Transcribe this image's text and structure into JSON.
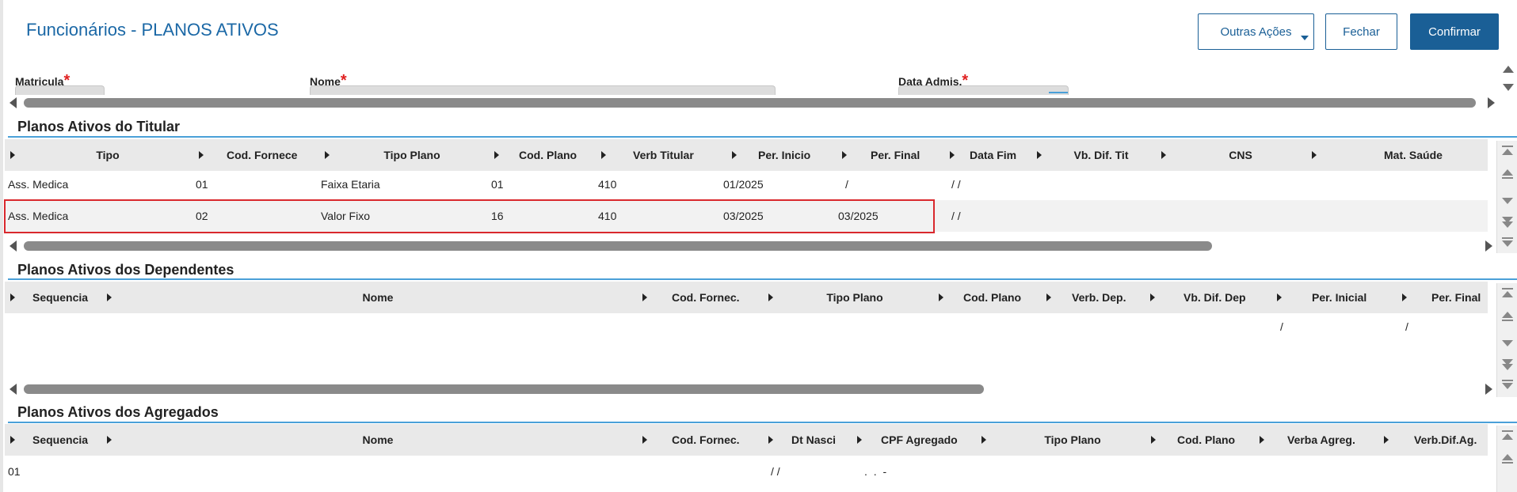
{
  "header": {
    "title": "Funcionários - PLANOS ATIVOS",
    "buttons": {
      "other_actions": "Outras Ações",
      "close": "Fechar",
      "confirm": "Confirmar"
    }
  },
  "form": {
    "matricula_label": "Matricula",
    "nome_label": "Nome",
    "data_admis_label": "Data Admis.",
    "required_mark": "*"
  },
  "titular": {
    "title": "Planos Ativos do Titular",
    "columns": [
      "Tipo",
      "Cod. Fornece",
      "Tipo Plano",
      "Cod. Plano",
      "Verb Titular",
      "Per. Inicio",
      "Per. Final",
      "Data Fim",
      "Vb. Dif. Tit",
      "CNS",
      "Mat. Saúde"
    ],
    "rows": [
      [
        "Ass. Medica",
        "01",
        "Faixa Etaria",
        "01",
        "410",
        "01/2025",
        "/",
        "/ /"
      ],
      [
        "Ass. Medica",
        "02",
        "Valor Fixo",
        "16",
        "410",
        "03/2025",
        "03/2025",
        "/ /"
      ]
    ]
  },
  "dependentes": {
    "title": "Planos Ativos dos Dependentes",
    "columns": [
      "Sequencia",
      "Nome",
      "Cod. Fornec.",
      "Tipo Plano",
      "Cod. Plano",
      "Verb. Dep.",
      "Vb. Dif. Dep",
      "Per. Inicial",
      "Per. Final"
    ],
    "row": [
      "/",
      "/"
    ]
  },
  "agregados": {
    "title": "Planos Ativos dos Agregados",
    "columns": [
      "Sequencia",
      "Nome",
      "Cod. Fornec.",
      "Dt Nasci",
      "CPF Agregado",
      "Tipo Plano",
      "Cod. Plano",
      "Verba Agreg.",
      "Verb.Dif.Ag."
    ],
    "row": [
      "01",
      "/ /",
      ".   .   -"
    ]
  },
  "colors": {
    "accent": "#1a5f96",
    "title": "#1b68a6",
    "required": "#e02020",
    "highlight": "#d9282d",
    "section_line": "#4aa0d8"
  },
  "icons": [
    "caret-down-icon",
    "column-sort-icon",
    "scroll-left-icon",
    "scroll-right-icon",
    "scroll-up-icon",
    "scroll-down-icon",
    "scroll-top-icon",
    "scroll-bottom-icon"
  ]
}
